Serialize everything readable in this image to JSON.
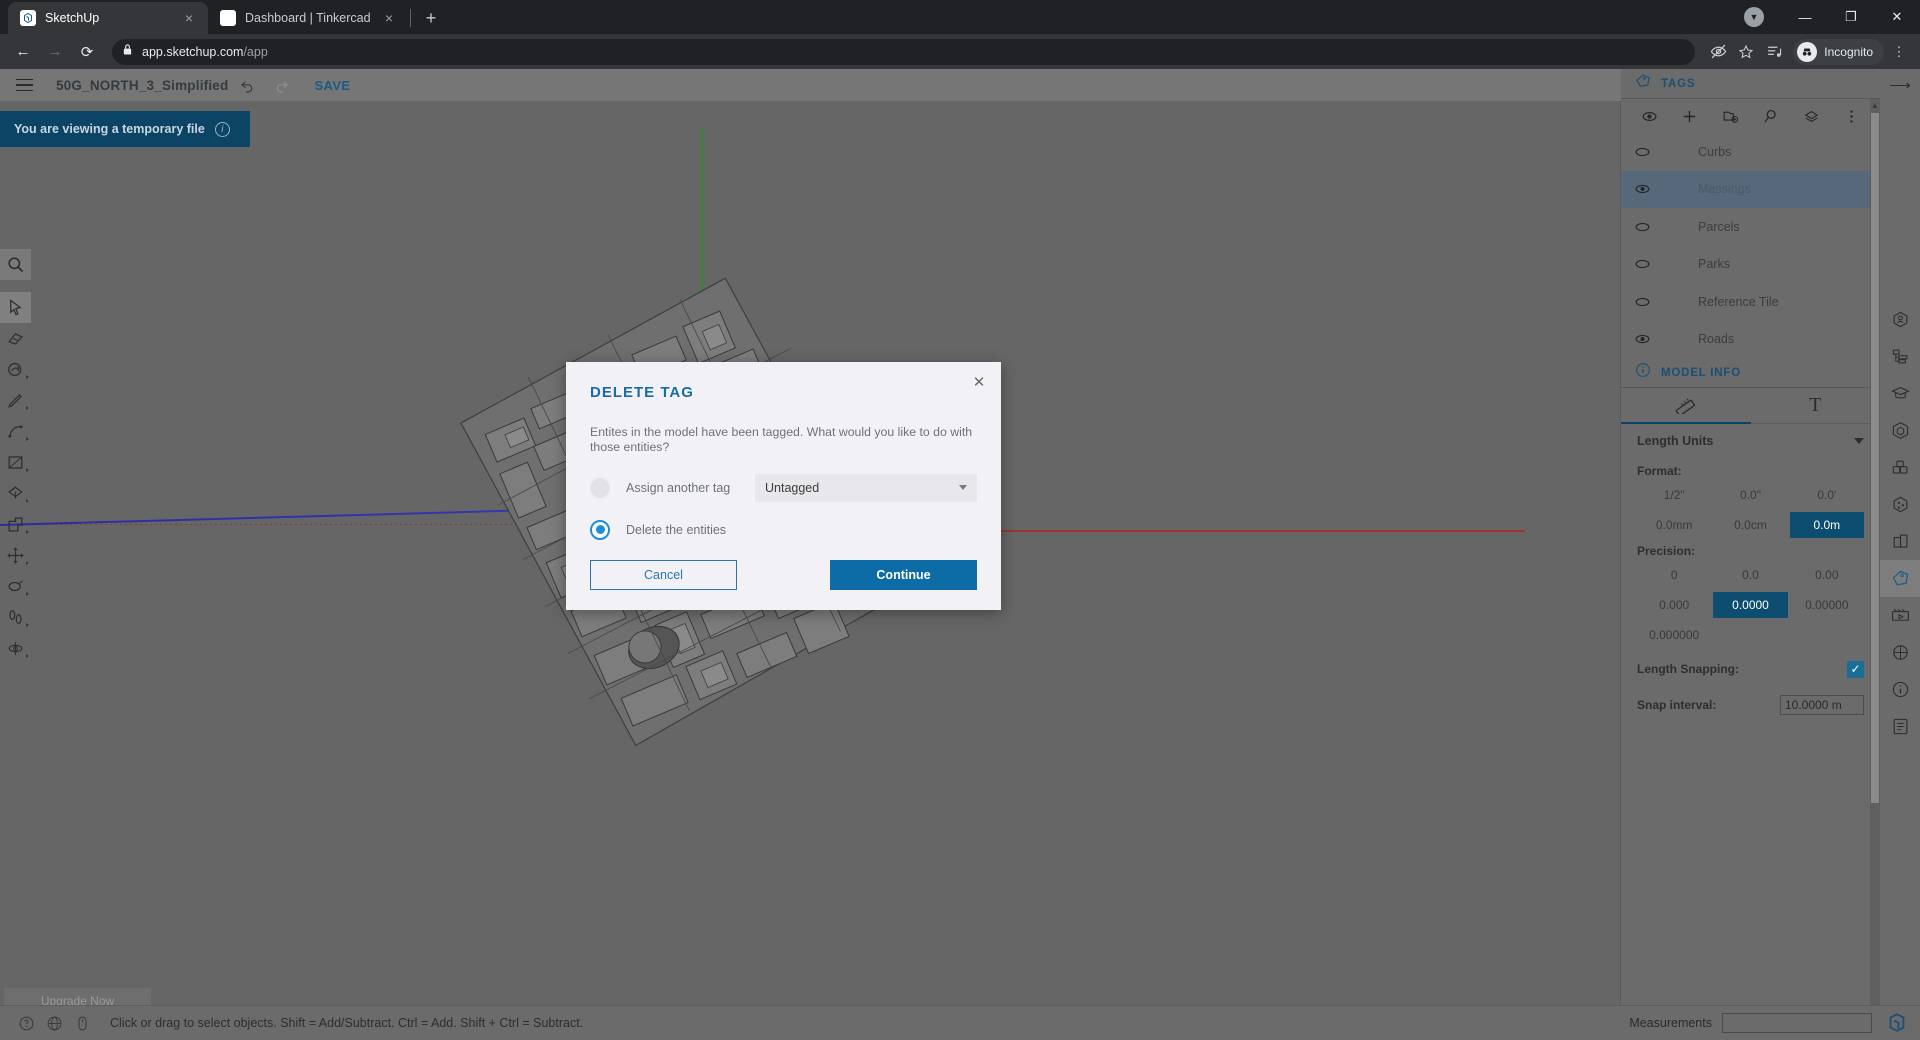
{
  "browser": {
    "tabs": [
      {
        "title": "SketchUp",
        "favicon": "sketchup-icon",
        "active": true,
        "close_label": "×"
      },
      {
        "title": "Dashboard | Tinkercad",
        "favicon": "tinkercad-icon",
        "active": false,
        "close_label": "×"
      }
    ],
    "new_tab_label": "+",
    "window_controls": {
      "minimize": "—",
      "maximize": "❐",
      "close": "✕"
    },
    "nav": {
      "back": "←",
      "forward": "→",
      "reload": "⟳"
    },
    "address": {
      "lock_icon": "lock-icon",
      "host": "app.sketchup.com",
      "path": "/app"
    },
    "toolbar_icons": {
      "hide_tracking": "eye-slash-icon",
      "bookmark": "star-icon",
      "reading_list": "reading-list-icon",
      "menu": "⋮"
    },
    "incognito_label": "Incognito"
  },
  "app_bar": {
    "menu_icon": "hamburger-icon",
    "document_title": "50G_NORTH_3_Simplified",
    "undo_icon": "undo-icon",
    "redo_icon": "redo-icon",
    "save_label": "SAVE"
  },
  "temp_banner": {
    "text": "You are viewing a temporary file",
    "info_icon": "info-icon",
    "bg_color": "#0c4466"
  },
  "left_toolbar": {
    "tools": [
      {
        "name": "search-tool",
        "icon": "magnifier-icon",
        "has_flyout": false
      },
      {
        "name": "select-tool",
        "icon": "cursor-arrow-icon",
        "has_flyout": false,
        "active": true
      },
      {
        "name": "eraser-tool",
        "icon": "eraser-icon",
        "has_flyout": false
      },
      {
        "name": "paint-tool",
        "icon": "paint-bucket-icon",
        "has_flyout": true
      },
      {
        "name": "line-tool",
        "icon": "pencil-icon",
        "has_flyout": true
      },
      {
        "name": "arc-tool",
        "icon": "arc-icon",
        "has_flyout": true
      },
      {
        "name": "rectangle-tool",
        "icon": "rectangle-icon",
        "has_flyout": true
      },
      {
        "name": "pushpull-tool",
        "icon": "pushpull-icon",
        "has_flyout": true
      },
      {
        "name": "offset-tool",
        "icon": "offset-icon",
        "has_flyout": true
      },
      {
        "name": "move-tool",
        "icon": "move-arrows-icon",
        "has_flyout": true
      },
      {
        "name": "rotate-tool",
        "icon": "rotate-icon",
        "has_flyout": true
      },
      {
        "name": "walk-tool",
        "icon": "footprints-icon",
        "has_flyout": true
      },
      {
        "name": "section-tool",
        "icon": "section-plane-icon",
        "has_flyout": true
      }
    ],
    "upgrade_label": "Upgrade Now"
  },
  "tags_panel": {
    "title": "TAGS",
    "title_icon": "tag-icon",
    "toolbar": [
      {
        "name": "visibility-toggle",
        "icon": "eye-icon"
      },
      {
        "name": "add-tag",
        "icon": "plus-icon"
      },
      {
        "name": "add-tag-folder",
        "icon": "folder-plus-icon"
      },
      {
        "name": "tag-details",
        "icon": "magnifier-icon"
      },
      {
        "name": "color-by-tag",
        "icon": "layers-icon"
      },
      {
        "name": "tags-overflow-menu",
        "icon": "kebab-menu-icon"
      }
    ],
    "tags": [
      {
        "label": "Curbs",
        "visible": false,
        "selected": false
      },
      {
        "label": "Massings",
        "visible": true,
        "selected": true
      },
      {
        "label": "Parcels",
        "visible": false,
        "selected": false
      },
      {
        "label": "Parks",
        "visible": false,
        "selected": false
      },
      {
        "label": "Reference Tile",
        "visible": false,
        "selected": false
      },
      {
        "label": "Roads",
        "visible": true,
        "selected": false
      }
    ]
  },
  "model_info": {
    "title": "MODEL INFO",
    "title_icon": "info-icon",
    "tabs": [
      {
        "name": "units-tab",
        "icon": "ruler-icon",
        "active": true
      },
      {
        "name": "text-tab",
        "icon": "text-icon",
        "active": false
      }
    ],
    "length_units": {
      "section_label": "Length Units",
      "format_label": "Format:",
      "format_options": [
        "1/2\"",
        "0.0\"",
        "0.0'",
        "0.0mm",
        "0.0cm",
        "0.0m"
      ],
      "format_selected": "0.0m",
      "precision_label": "Precision:",
      "precision_options": [
        "0",
        "0.0",
        "0.00",
        "0.000",
        "0.0000",
        "0.00000",
        "0.000000"
      ],
      "precision_selected": "0.0000",
      "length_snapping_label": "Length Snapping:",
      "length_snapping_checked": true,
      "snap_interval_label": "Snap interval:",
      "snap_interval_value": "10.0000 m"
    }
  },
  "far_rail": {
    "collapse_icon": "arrow-right-icon",
    "icons": [
      {
        "name": "3d-warehouse-icon"
      },
      {
        "name": "outliner-icon"
      },
      {
        "name": "learn-icon"
      },
      {
        "name": "components-icon"
      },
      {
        "name": "materials-icon"
      },
      {
        "name": "styles-icon"
      },
      {
        "name": "scenes-icon"
      },
      {
        "name": "tags-icon",
        "active": true
      },
      {
        "name": "animation-icon"
      },
      {
        "name": "display-icon"
      },
      {
        "name": "entity-info-icon"
      },
      {
        "name": "instructor-icon"
      }
    ]
  },
  "status_bar": {
    "help_icon": "question-circle-icon",
    "globe_icon": "globe-icon",
    "mouse_icon": "mouse-icon",
    "hint": "Click or drag to select objects. Shift = Add/Subtract. Ctrl = Add. Shift + Ctrl = Subtract.",
    "measurements_label": "Measurements",
    "measurements_value": "",
    "logo_icon": "sketchup-logo-icon"
  },
  "dialog": {
    "title": "DELETE TAG",
    "close_label": "✕",
    "description": "Entites in the model have been tagged. What would you like to do with those entities?",
    "options": [
      {
        "label": "Assign another tag",
        "selected": false
      },
      {
        "label": "Delete the entities",
        "selected": true
      }
    ],
    "tag_select_value": "Untagged",
    "cancel_label": "Cancel",
    "continue_label": "Continue",
    "accent_color": "#0d6ba5"
  }
}
